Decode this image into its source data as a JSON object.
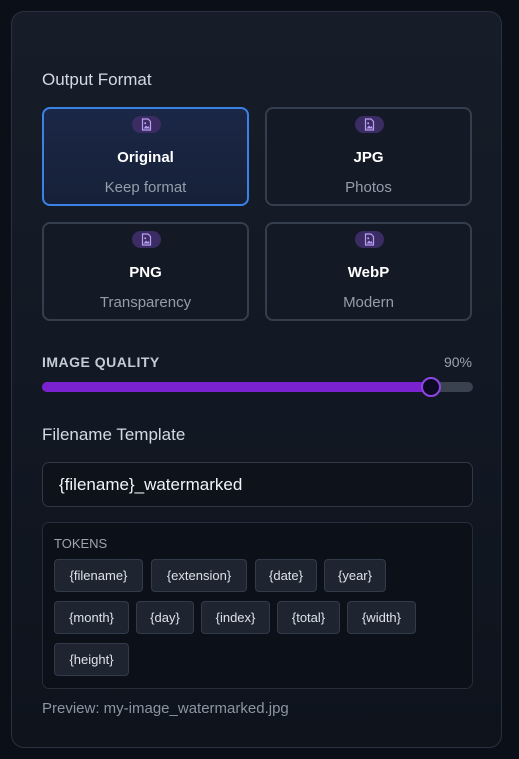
{
  "output_format": {
    "title": "Output Format",
    "options": [
      {
        "name": "Original",
        "desc": "Keep format",
        "icon": "image-file-icon",
        "selected": true
      },
      {
        "name": "JPG",
        "desc": "Photos",
        "icon": "image-file-icon",
        "selected": false
      },
      {
        "name": "PNG",
        "desc": "Transparency",
        "icon": "image-file-icon",
        "selected": false
      },
      {
        "name": "WebP",
        "desc": "Modern",
        "icon": "image-file-icon",
        "selected": false
      }
    ]
  },
  "quality": {
    "label": "IMAGE QUALITY",
    "value_text": "90%",
    "value": 0.9
  },
  "filename_template": {
    "title": "Filename Template",
    "value": "{filename}_watermarked"
  },
  "tokens": {
    "title": "TOKENS",
    "items": [
      "{filename}",
      "{extension}",
      "{date}",
      "{year}",
      "{month}",
      "{day}",
      "{index}",
      "{total}",
      "{width}",
      "{height}"
    ]
  },
  "preview": "Preview: my-image_watermarked.jpg",
  "colors": {
    "accent": "#7b22d0",
    "selected_border": "#3b82e6",
    "icon_badge": "#3b2c63",
    "icon_stroke": "#b89ef5"
  }
}
